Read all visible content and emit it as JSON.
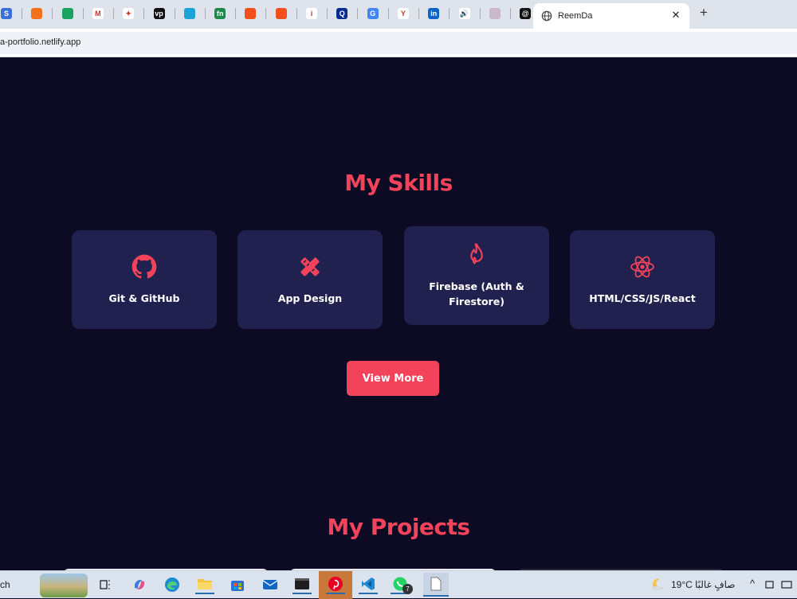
{
  "browser": {
    "pinned_tabs": [
      {
        "name": "app-tab",
        "color": "#3b6fd8",
        "glyph": "S"
      },
      {
        "name": "fire-tab",
        "color": "#f2711c",
        "glyph": ""
      },
      {
        "name": "calendar-tab",
        "color": "#1aa260",
        "glyph": ""
      },
      {
        "name": "gmail-tab",
        "color": "#ffffff",
        "glyph": "M"
      },
      {
        "name": "gemini-tab",
        "color": "#ffffff",
        "glyph": "✦"
      },
      {
        "name": "vp-tab",
        "color": "#111111",
        "glyph": "vp"
      },
      {
        "name": "circle-tab",
        "color": "#1aa3d4",
        "glyph": ""
      },
      {
        "name": "fn-tab",
        "color": "#1f8a4c",
        "glyph": "fn"
      },
      {
        "name": "figma-tab",
        "color": "#f24e1e",
        "glyph": ""
      },
      {
        "name": "figma-tab-2",
        "color": "#f24e1e",
        "glyph": ""
      },
      {
        "name": "info-tab",
        "color": "#ffffff",
        "glyph": "i"
      },
      {
        "name": "q-tab",
        "color": "#0a2c8f",
        "glyph": "Q"
      },
      {
        "name": "google-tab",
        "color": "#4285f4",
        "glyph": "G"
      },
      {
        "name": "y-tab",
        "color": "#ffffff",
        "glyph": "Y"
      },
      {
        "name": "linkedin-tab",
        "color": "#0a66c2",
        "glyph": "in"
      },
      {
        "name": "speaker-tab",
        "color": "#ffffff",
        "glyph": "🔊"
      },
      {
        "name": "image-tab",
        "color": "#c9b8c8",
        "glyph": ""
      },
      {
        "name": "threads-tab",
        "color": "#111111",
        "glyph": "@"
      }
    ],
    "active_tab_title": "ReemDa",
    "close_glyph": "✕",
    "new_tab_glyph": "+",
    "url": "a-portfolio.netlify.app"
  },
  "skills": {
    "title": "My Skills",
    "items": [
      {
        "label": "Git & GitHub",
        "icon": "github-icon"
      },
      {
        "label": "App Design",
        "icon": "design-tools-icon"
      },
      {
        "label": "Firebase (Auth & Firestore)",
        "icon": "firebase-icon"
      },
      {
        "label": "HTML/CSS/JS/React",
        "icon": "react-icon"
      }
    ],
    "view_more": "View More"
  },
  "projects": {
    "title": "My Projects"
  },
  "taskbar": {
    "search_text": "ch",
    "weather_temp": "19°C",
    "weather_desc": "صافٍ غالبًا",
    "whatsapp_badge": "7"
  },
  "colors": {
    "accent": "#f2435b",
    "background": "#0c0b23",
    "card": "#212150"
  }
}
